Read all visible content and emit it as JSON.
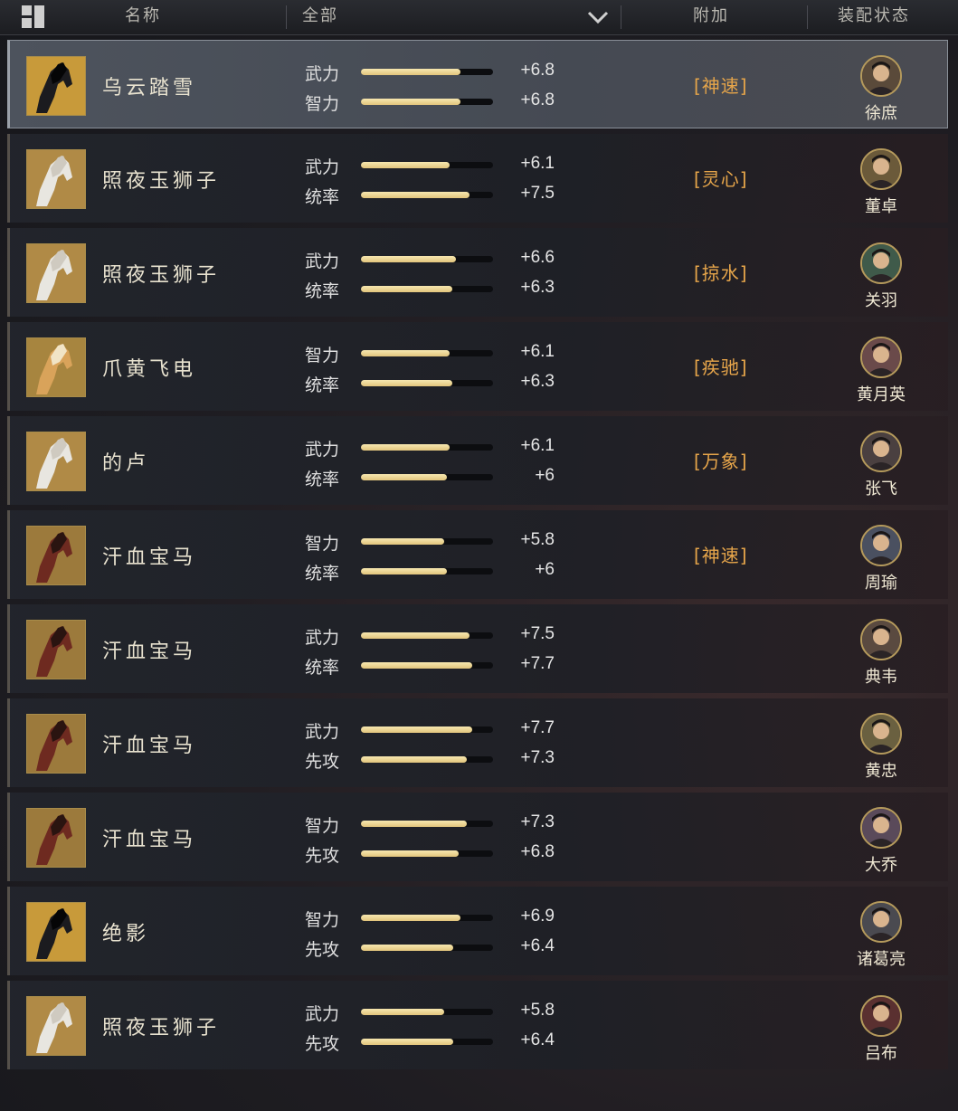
{
  "header": {
    "name_label": "名称",
    "filter_label": "全部",
    "bonus_label": "附加",
    "status_label": "装配状态"
  },
  "rows": [
    {
      "name": "乌云踏雪",
      "horse": "black",
      "stats": [
        {
          "label": "武力",
          "value": "+6.8",
          "fill": 0.75
        },
        {
          "label": "智力",
          "value": "+6.8",
          "fill": 0.75
        }
      ],
      "bonus": "[神速]",
      "general": "徐庶",
      "selected": true
    },
    {
      "name": "照夜玉狮子",
      "horse": "white",
      "stats": [
        {
          "label": "武力",
          "value": "+6.1",
          "fill": 0.67
        },
        {
          "label": "统率",
          "value": "+7.5",
          "fill": 0.82
        }
      ],
      "bonus": "[灵心]",
      "general": "董卓"
    },
    {
      "name": "照夜玉狮子",
      "horse": "white",
      "stats": [
        {
          "label": "武力",
          "value": "+6.6",
          "fill": 0.72
        },
        {
          "label": "统率",
          "value": "+6.3",
          "fill": 0.69
        }
      ],
      "bonus": "[掠水]",
      "general": "关羽"
    },
    {
      "name": "爪黄飞电",
      "horse": "gold",
      "stats": [
        {
          "label": "智力",
          "value": "+6.1",
          "fill": 0.67
        },
        {
          "label": "统率",
          "value": "+6.3",
          "fill": 0.69
        }
      ],
      "bonus": "[疾驰]",
      "general": "黄月英"
    },
    {
      "name": "的卢",
      "horse": "white",
      "stats": [
        {
          "label": "武力",
          "value": "+6.1",
          "fill": 0.67
        },
        {
          "label": "统率",
          "value": "+6",
          "fill": 0.65
        }
      ],
      "bonus": "[万象]",
      "general": "张飞"
    },
    {
      "name": "汗血宝马",
      "horse": "red",
      "stats": [
        {
          "label": "智力",
          "value": "+5.8",
          "fill": 0.63
        },
        {
          "label": "统率",
          "value": "+6",
          "fill": 0.65
        }
      ],
      "bonus": "[神速]",
      "general": "周瑜"
    },
    {
      "name": "汗血宝马",
      "horse": "red",
      "stats": [
        {
          "label": "武力",
          "value": "+7.5",
          "fill": 0.82
        },
        {
          "label": "统率",
          "value": "+7.7",
          "fill": 0.84
        }
      ],
      "bonus": "",
      "general": "典韦"
    },
    {
      "name": "汗血宝马",
      "horse": "red",
      "stats": [
        {
          "label": "武力",
          "value": "+7.7",
          "fill": 0.84
        },
        {
          "label": "先攻",
          "value": "+7.3",
          "fill": 0.8
        }
      ],
      "bonus": "",
      "general": "黄忠"
    },
    {
      "name": "汗血宝马",
      "horse": "red",
      "stats": [
        {
          "label": "智力",
          "value": "+7.3",
          "fill": 0.8
        },
        {
          "label": "先攻",
          "value": "+6.8",
          "fill": 0.74
        }
      ],
      "bonus": "",
      "general": "大乔"
    },
    {
      "name": "绝影",
      "horse": "black",
      "stats": [
        {
          "label": "智力",
          "value": "+6.9",
          "fill": 0.75
        },
        {
          "label": "先攻",
          "value": "+6.4",
          "fill": 0.7
        }
      ],
      "bonus": "",
      "general": "诸葛亮"
    },
    {
      "name": "照夜玉狮子",
      "horse": "white",
      "stats": [
        {
          "label": "武力",
          "value": "+5.8",
          "fill": 0.63
        },
        {
          "label": "先攻",
          "value": "+6.4",
          "fill": 0.7
        }
      ],
      "bonus": "",
      "general": "吕布"
    }
  ]
}
